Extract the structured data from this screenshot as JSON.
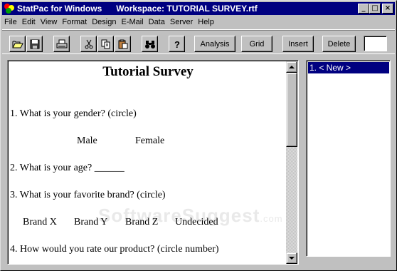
{
  "window": {
    "app_title": "StatPac for Windows",
    "workspace_title": "Workspace: TUTORIAL SURVEY.rtf",
    "minimize_glyph": "_",
    "maximize_glyph": "□",
    "close_glyph": "×"
  },
  "menu": [
    {
      "label": "File"
    },
    {
      "label": "Edit"
    },
    {
      "label": "View"
    },
    {
      "label": "Format"
    },
    {
      "label": "Design"
    },
    {
      "label": "E-Mail"
    },
    {
      "label": "Data"
    },
    {
      "label": "Server"
    },
    {
      "label": "Help"
    }
  ],
  "toolbar": {
    "icons": [
      "open-folder-icon",
      "save-icon",
      "print-icon",
      "cut-icon",
      "copy-icon",
      "paste-icon",
      "find-icon",
      "help-icon"
    ],
    "analysis_label": "Analysis",
    "grid_label": "Grid",
    "insert_label": "Insert",
    "delete_label": "Delete",
    "input_value": ""
  },
  "document": {
    "title": "Tutorial Survey",
    "q1": "1. What is your gender?  (circle)",
    "q1_opt1": "Male",
    "q1_opt2": "Female",
    "q2": "2. What is your age? ______",
    "q3": "3. What is your favorite brand?  (circle)",
    "q3_opt1": "Brand X",
    "q3_opt2": "Brand Y",
    "q3_opt3": "Brand Z",
    "q3_opt4": "Undecided",
    "q4": "4. How would you rate our product?  (circle number)"
  },
  "list": {
    "items": [
      {
        "label": "1. < New >",
        "selected": true
      }
    ]
  },
  "watermark": {
    "text": "SoftwareSuggest",
    "tld": ".com"
  },
  "colors": {
    "titlebar": "#000080",
    "face": "#c0c0c0",
    "selection": "#000080"
  }
}
